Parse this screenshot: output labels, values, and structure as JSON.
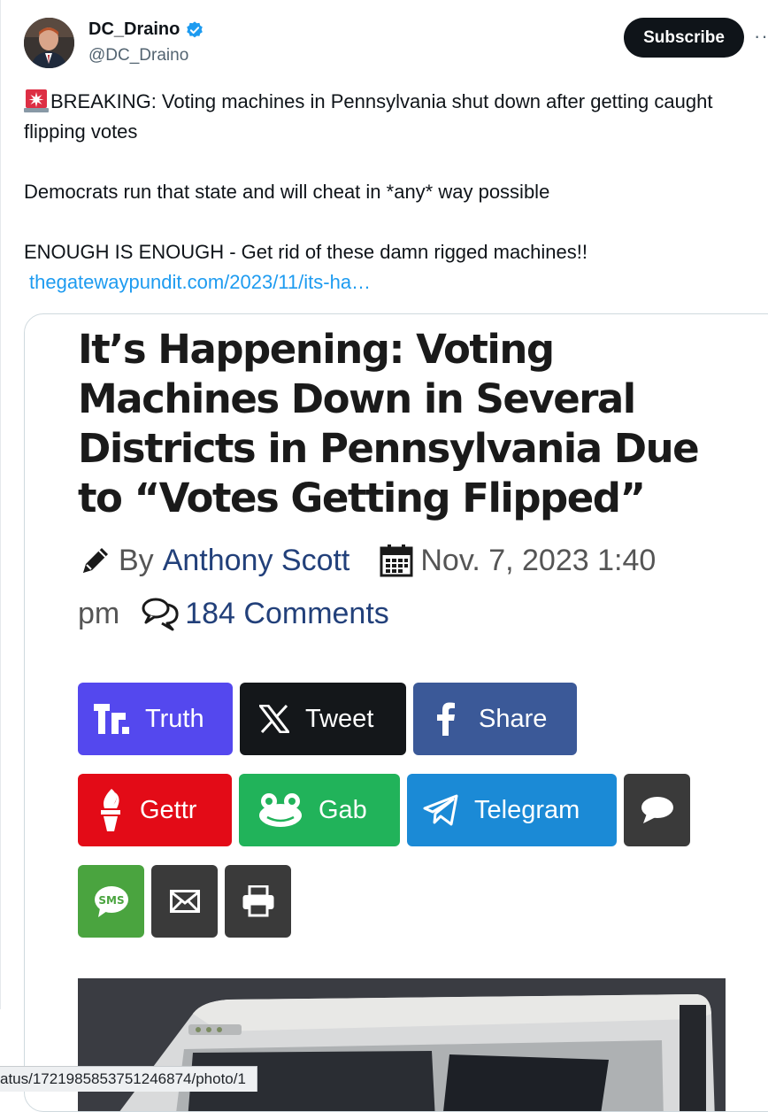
{
  "author": {
    "display_name": "DC_Draino",
    "handle": "@DC_Draino",
    "verified": true
  },
  "actions": {
    "subscribe_label": "Subscribe",
    "more_label": "··"
  },
  "tweet": {
    "line1": "BREAKING: Voting machines in Pennsylvania shut down after getting caught flipping votes",
    "line2": "Democrats run that state and will cheat in *any* way possible",
    "line3": "ENOUGH IS ENOUGH - Get rid of these damn rigged machines!!",
    "link_text": "thegatewaypundit.com/2023/11/its-ha…",
    "emoji": "rotating-light-icon"
  },
  "card": {
    "headline": "It’s Happening: Voting Machines Down in Several Districts in Pennsylvania Due to “Votes Getting Flipped”",
    "by_label": "By",
    "author_name": "Anthony Scott",
    "date_part1": "Nov. 7, 2023 1:40",
    "date_part2": "pm",
    "comments_label": "184 Comments",
    "share_buttons": [
      {
        "label": "Truth",
        "color": "#5448ee",
        "icon": "truth-social-icon"
      },
      {
        "label": "Tweet",
        "color": "#14171a",
        "icon": "x-logo-icon"
      },
      {
        "label": "Share",
        "color": "#3b5998",
        "icon": "facebook-icon"
      },
      {
        "label": "Gettr",
        "color": "#e30b17",
        "icon": "gettr-torch-icon"
      },
      {
        "label": "Gab",
        "color": "#21b35a",
        "icon": "gab-frog-icon"
      },
      {
        "label": "Telegram",
        "color": "#1b8ad6",
        "icon": "telegram-plane-icon"
      },
      {
        "label": "",
        "color": "#3a3a3a",
        "icon": "chat-bubble-icon"
      },
      {
        "label": "",
        "color": "#4aa43f",
        "icon": "sms-icon"
      },
      {
        "label": "",
        "color": "#3a3a3a",
        "icon": "envelope-icon"
      },
      {
        "label": "",
        "color": "#3a3a3a",
        "icon": "printer-icon"
      }
    ]
  },
  "status_bar": {
    "url": "atus/1721985853751246874/photo/1"
  }
}
